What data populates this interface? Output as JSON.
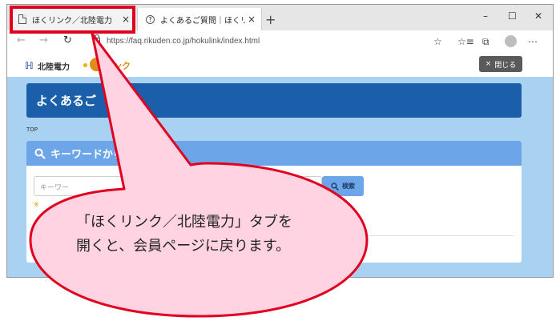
{
  "browser": {
    "tabs": [
      {
        "label": "ほくリンク／北陸電力",
        "close": "×"
      },
      {
        "label": "よくあるご質問｜ほくリンク",
        "close": "×"
      }
    ],
    "new_tab": "+",
    "window_controls": {
      "minimize": "–",
      "maximize": "☐",
      "close": "✕"
    },
    "nav": {
      "back": "←",
      "forward": "→",
      "reload": "↻"
    },
    "url": "https://faq.rikuden.co.jp/hokulink/index.html",
    "toolbar_icons": {
      "favorite": "☆",
      "favorites_bar": "☆≡",
      "collections": "⧉",
      "menu": "⋯"
    }
  },
  "site": {
    "logo_text": "北陸電力",
    "logo_mark": "ℍ",
    "logo_link_text": "リンク",
    "close_button": {
      "icon": "×",
      "label": "閉じる"
    },
    "title_banner": "よくあるご",
    "breadcrumb": "TOP",
    "search": {
      "heading": "キーワードから",
      "placeholder": "キーワー",
      "button_label": "検索",
      "hint": "※"
    }
  },
  "annotation": {
    "line1": "「ほくリンク／北陸電力」タブを",
    "line2": "開くと、会員ページに戻ります。",
    "highlight_color": "#e1001f",
    "bubble_color": "#ffd3e2"
  }
}
